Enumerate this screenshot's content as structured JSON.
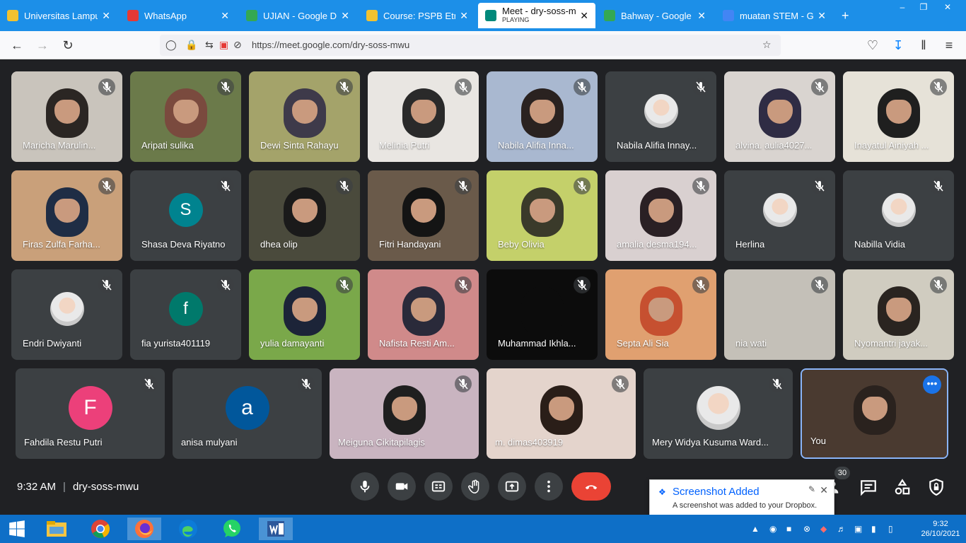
{
  "browser": {
    "tabs": [
      {
        "label": "Universitas Lampung",
        "icon": "university-icon",
        "color": "#f2c230"
      },
      {
        "label": "WhatsApp",
        "icon": "whatsapp-alert-icon",
        "color": "#e53935"
      },
      {
        "label": "UJIAN - Google Drive",
        "icon": "google-drive-icon",
        "color": "#34a853"
      },
      {
        "label": "Course: PSPB Etnosai",
        "icon": "course-icon",
        "color": "#f2c230"
      },
      {
        "label": "Meet - dry-soss-mwu",
        "sublabel": "PLAYING",
        "icon": "google-meet-icon",
        "color": "#00897b",
        "active": true
      },
      {
        "label": "Bahway - Google Ma",
        "icon": "google-maps-icon",
        "color": "#34a853"
      },
      {
        "label": "muatan STEM - Goog",
        "icon": "google-icon",
        "color": "#4285f4"
      }
    ],
    "url": "https://meet.google.com/dry-soss-mwu"
  },
  "participants_rows": [
    [
      {
        "name": "Maricha Marulin...",
        "kind": "video",
        "bg": "#c9c4bc",
        "face": "#2b2623"
      },
      {
        "name": "Aripati sulika",
        "kind": "video",
        "bg": "#6b7a4a",
        "face": "#7a4a3e"
      },
      {
        "name": "Dewi Sinta Rahayu",
        "kind": "video",
        "bg": "#a4a36a",
        "face": "#3e3a4a"
      },
      {
        "name": "Melinia Putri",
        "kind": "video",
        "bg": "#e9e6e2",
        "face": "#2a2a2a"
      },
      {
        "name": "Nabila Alifia Inna...",
        "kind": "video",
        "bg": "#a9b8d0",
        "face": "#2a2220"
      },
      {
        "name": "Nabila Alifia Innay...",
        "kind": "photo"
      },
      {
        "name": "alvina. aulia4027...",
        "kind": "video",
        "bg": "#d9d4d0",
        "face": "#2f2c44"
      },
      {
        "name": "Inayatul Ainiyah ...",
        "kind": "video",
        "bg": "#e6e2d8",
        "face": "#1f1f1f"
      }
    ],
    [
      {
        "name": "Firas Zulfa Farha...",
        "kind": "video",
        "bg": "#c9a07a",
        "face": "#1f2d45"
      },
      {
        "name": "Shasa Deva Riyatno",
        "kind": "letter",
        "letter": "S",
        "color": "#00838f"
      },
      {
        "name": "dhea olip",
        "kind": "video",
        "bg": "#4a4a3c",
        "face": "#1a1a1a"
      },
      {
        "name": "Fitri Handayani",
        "kind": "video",
        "bg": "#6a5a4a",
        "face": "#141414"
      },
      {
        "name": "Beby Olivia",
        "kind": "video",
        "bg": "#c4d06a",
        "face": "#3a3a2a"
      },
      {
        "name": "amalia desma194...",
        "kind": "video",
        "bg": "#d9d0d0",
        "face": "#2a2024"
      },
      {
        "name": "Herlina",
        "kind": "photo"
      },
      {
        "name": "Nabilla Vidia",
        "kind": "photo"
      }
    ],
    [
      {
        "name": "Endri Dwiyanti",
        "kind": "photo"
      },
      {
        "name": "fia yurista401119",
        "kind": "letter",
        "letter": "f",
        "color": "#00796b"
      },
      {
        "name": "yulia damayanti",
        "kind": "video",
        "bg": "#7aa84a",
        "face": "#1c2438"
      },
      {
        "name": "Nafista Resti Am...",
        "kind": "video",
        "bg": "#d08a8a",
        "face": "#2a2a3a"
      },
      {
        "name": "Muhammad Ikhla...",
        "kind": "video",
        "bg": "#0c0c0c",
        "face": "#0c0c0c"
      },
      {
        "name": "Septa Ali Sia",
        "kind": "video",
        "bg": "#e0a070",
        "face": "#c65030"
      },
      {
        "name": "nia wati",
        "kind": "video",
        "bg": "#c4c0b8",
        "face": "#c4c0b8"
      },
      {
        "name": "Nyomantri jayak...",
        "kind": "video",
        "bg": "#d0ccc0",
        "face": "#2a2420"
      }
    ],
    [
      {
        "name": "Fahdila Restu Putri",
        "kind": "letter",
        "letter": "F",
        "color": "#ec407a"
      },
      {
        "name": "anisa mulyani",
        "kind": "letter",
        "letter": "a",
        "color": "#01579b"
      },
      {
        "name": "Meiguna Cikitapilagis",
        "kind": "video",
        "bg": "#c9b4c0",
        "face": "#1f1f1f"
      },
      {
        "name": "m. dimas403919",
        "kind": "video",
        "bg": "#e4d4cc",
        "face": "#2a1e18"
      },
      {
        "name": "Mery Widya Kusuma Ward...",
        "kind": "photo"
      },
      {
        "name": "You",
        "kind": "video",
        "bg": "#4a3a30",
        "face": "#2a221e",
        "self": true
      }
    ]
  ],
  "meeting": {
    "time": "9:32 AM",
    "code": "dry-soss-mwu",
    "participant_count": "30"
  },
  "toast": {
    "title": "Screenshot Added",
    "body": "A screenshot was added to your Dropbox."
  },
  "taskbar": {
    "time": "9:32",
    "date": "26/10/2021"
  }
}
